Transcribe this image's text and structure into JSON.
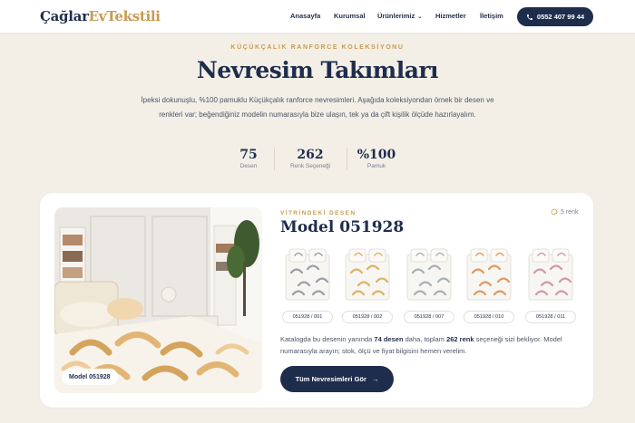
{
  "brand": {
    "logo_part1": "Çağlar",
    "logo_part2": "EvTekstili",
    "primary": "#1f2d4d",
    "accent": "#c99a50"
  },
  "nav": {
    "items": [
      {
        "label": "Anasayfa"
      },
      {
        "label": "Kurumsal"
      },
      {
        "label": "Ürünlerimiz",
        "has_dropdown": true
      },
      {
        "label": "Hizmetler"
      },
      {
        "label": "İletişim"
      }
    ],
    "phone": "0552 407 99 44"
  },
  "hero": {
    "eyebrow": "KÜÇÜKÇALIK RANFORCE KOLEKSİYONU",
    "title": "Nevresim Takımları",
    "description": "İpeksi dokunuşlu, %100 pamuklu Küçükçalık ranforce nevresimleri. Aşağıda koleksiyondan örnek bir desen ve renkleri var; beğendiğiniz modelin numarasıyla bize ulaşın, tek ya da çift kişilik ölçüde hazırlayalım.",
    "stats": [
      {
        "value": "75",
        "label": "Desen"
      },
      {
        "value": "262",
        "label": "Renk Seçeneği"
      },
      {
        "value": "%100",
        "label": "Pamuk"
      }
    ]
  },
  "showcase": {
    "image_tag": "Model 051928",
    "eyebrow": "VİTRİNDEKİ DESEN",
    "title": "Model 051928",
    "color_count": "5 renk",
    "swatches": [
      {
        "label": "051928 / 001",
        "color": "#8a8f99"
      },
      {
        "label": "051928 / 002",
        "color": "#d9a84a"
      },
      {
        "label": "051928 / 007",
        "color": "#9aa3ad"
      },
      {
        "label": "051928 / 010",
        "color": "#d98a4a"
      },
      {
        "label": "051928 / 011",
        "color": "#c98a9a"
      }
    ],
    "desc_pre": "Katalogda bu desenin yanında ",
    "desc_b1": "74 desen",
    "desc_mid": " daha, toplam ",
    "desc_b2": "262 renk",
    "desc_post": " seçeneği sizi bekliyor. Model numarasıyla arayın; stok, ölçü ve fiyat bilgisini hemen verelim.",
    "cta_label": "Tüm Nevresimleri Gör"
  }
}
